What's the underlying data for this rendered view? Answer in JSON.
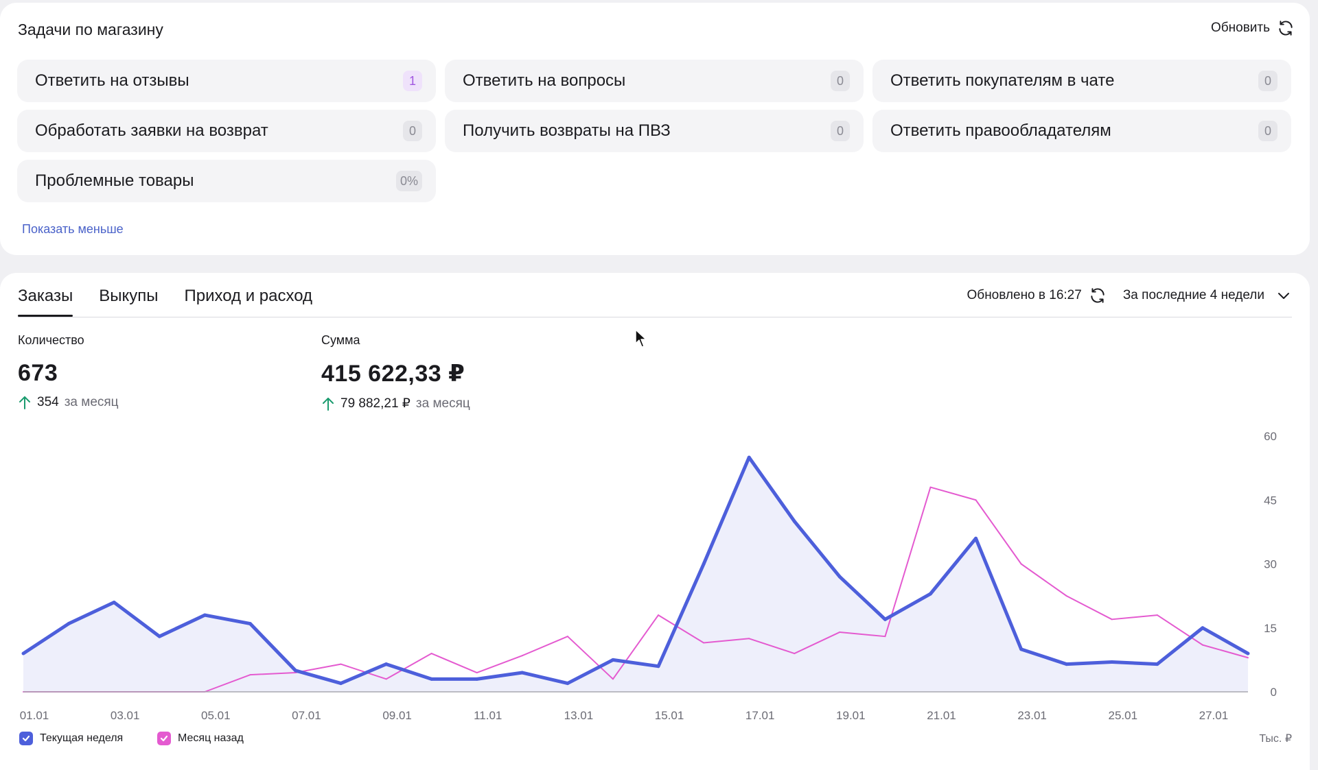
{
  "tasks": {
    "title": "Задачи по магазину",
    "refresh_label": "Обновить",
    "items": [
      {
        "label": "Ответить на отзывы",
        "count": "1"
      },
      {
        "label": "Ответить на вопросы",
        "count": "0"
      },
      {
        "label": "Ответить покупателям в чате",
        "count": "0"
      },
      {
        "label": "Обработать заявки на возврат",
        "count": "0"
      },
      {
        "label": "Получить возвраты на ПВЗ",
        "count": "0"
      },
      {
        "label": "Ответить правообладателям",
        "count": "0"
      },
      {
        "label": "Проблемные товары",
        "count": "0%"
      }
    ],
    "show_less": "Показать меньше"
  },
  "orders": {
    "tabs": [
      "Заказы",
      "Выкупы",
      "Приход и расход"
    ],
    "active_tab": "Заказы",
    "updated": "Обновлено в 16:27",
    "period": "За последние 4 недели",
    "metrics": {
      "quantity": {
        "label": "Количество",
        "value": "673",
        "delta": "354",
        "delta_suffix": "за месяц"
      },
      "sum": {
        "label": "Сумма",
        "value": "415 622,33 ₽",
        "delta": "79 882,21 ₽",
        "delta_suffix": "за месяц"
      }
    },
    "legend": {
      "current": "Текущая неделя",
      "previous": "Месяц назад"
    },
    "unit": "Тыс. ₽"
  },
  "colors": {
    "current_line": "#4d5fdb",
    "previous_line": "#e45ad0",
    "area_fill": "#ecedfb",
    "delta_up": "#1a9b6e"
  },
  "icons": [
    "refresh-icon",
    "chevron-down-icon",
    "arrow-up-icon",
    "checkbox-icon",
    "cursor-icon"
  ],
  "chart_data": {
    "type": "area",
    "x": [
      "01.01",
      "02.01",
      "03.01",
      "04.01",
      "05.01",
      "06.01",
      "07.01",
      "08.01",
      "09.01",
      "10.01",
      "11.01",
      "12.01",
      "13.01",
      "14.01",
      "15.01",
      "16.01",
      "17.01",
      "18.01",
      "19.01",
      "20.01",
      "21.01",
      "22.01",
      "23.01",
      "24.01",
      "25.01",
      "26.01",
      "27.01",
      "28.01"
    ],
    "x_tick_labels": [
      "01.01",
      "03.01",
      "05.01",
      "07.01",
      "09.01",
      "11.01",
      "13.01",
      "15.01",
      "17.01",
      "19.01",
      "21.01",
      "23.01",
      "25.01",
      "27.01"
    ],
    "series": [
      {
        "name": "Текущая неделя",
        "type": "area",
        "values": [
          9,
          16,
          21,
          13,
          18,
          16,
          5,
          2,
          6.5,
          3,
          3,
          4.5,
          2,
          7.5,
          6,
          30,
          55,
          40,
          27,
          17,
          23,
          36,
          10,
          6.5,
          7,
          6.5,
          15,
          9
        ]
      },
      {
        "name": "Месяц назад",
        "type": "line",
        "values": [
          0,
          0,
          0,
          0,
          0,
          4,
          4.5,
          6.5,
          3,
          9,
          4.5,
          8.5,
          13,
          3,
          18,
          11.5,
          12.5,
          9,
          14,
          13,
          48,
          45,
          30,
          22.5,
          17,
          18,
          11,
          8
        ]
      }
    ],
    "ylabel": "Тыс. ₽",
    "y_axis_position": "right",
    "y_ticks": [
      0,
      15,
      30,
      45,
      60
    ],
    "ylim": [
      0,
      60
    ],
    "grid": false,
    "legend_position": "bottom-left"
  }
}
